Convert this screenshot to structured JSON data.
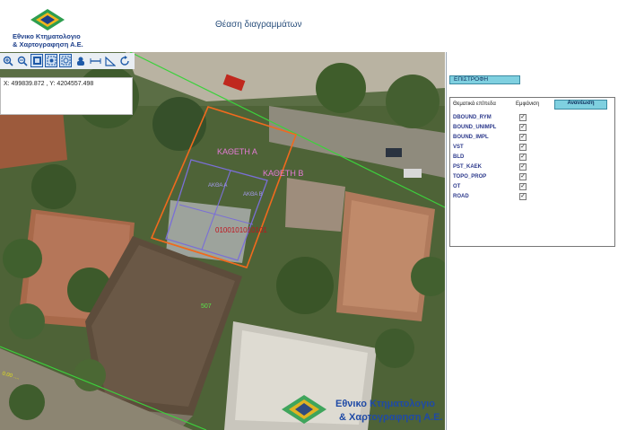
{
  "header": {
    "logo_line1": "Εθνικο Κτηματολογιο",
    "logo_line2": "& Χαρτογραφηση Α.Ε.",
    "title": "Θέαση διαγραμμάτων"
  },
  "toolbar": {
    "tools": [
      "zoom-in-icon",
      "zoom-out-icon",
      "full-extent-icon",
      "zoom-box-icon",
      "zoom-fit-icon",
      "pan-icon",
      "measure-distance-icon",
      "measure-area-icon",
      "refresh-icon"
    ]
  },
  "coords": {
    "text": "X: 499839.872 , Y: 4204557.498"
  },
  "map": {
    "label_katheti_a": "ΚΑΘΕΤΗ Α",
    "label_katheti_b": "ΚΑΘΕΤΗ Β",
    "label_plot_code": "0100101010101",
    "label_507": "507",
    "label_zone_a": "ΑΚΘΑ Α",
    "label_zone_b": "ΑΚΘΑ Β",
    "label_road": "0.00 ....",
    "watermark_line1": "Εθνικο Κτηματολογιο",
    "watermark_line2": "& Χαρτογραφηση Α.Ε."
  },
  "panel": {
    "back_label": "ΕΠΙΣΤΡΟΦΗ",
    "col_layers": "Θεματικά επίπεδα",
    "col_display": "Εμφάνιση",
    "refresh_label": "Ανανέωση",
    "layers": [
      {
        "name": "DBOUND_RYM",
        "checked": true
      },
      {
        "name": "BOUND_UNIMPL",
        "checked": true
      },
      {
        "name": "BOUND_IMPL",
        "checked": true
      },
      {
        "name": "VST",
        "checked": true
      },
      {
        "name": "BLD",
        "checked": true
      },
      {
        "name": "PST_KAEK",
        "checked": true
      },
      {
        "name": "TOPO_PROP",
        "checked": true
      },
      {
        "name": "OT",
        "checked": true
      },
      {
        "name": "ROAD",
        "checked": true
      }
    ]
  }
}
